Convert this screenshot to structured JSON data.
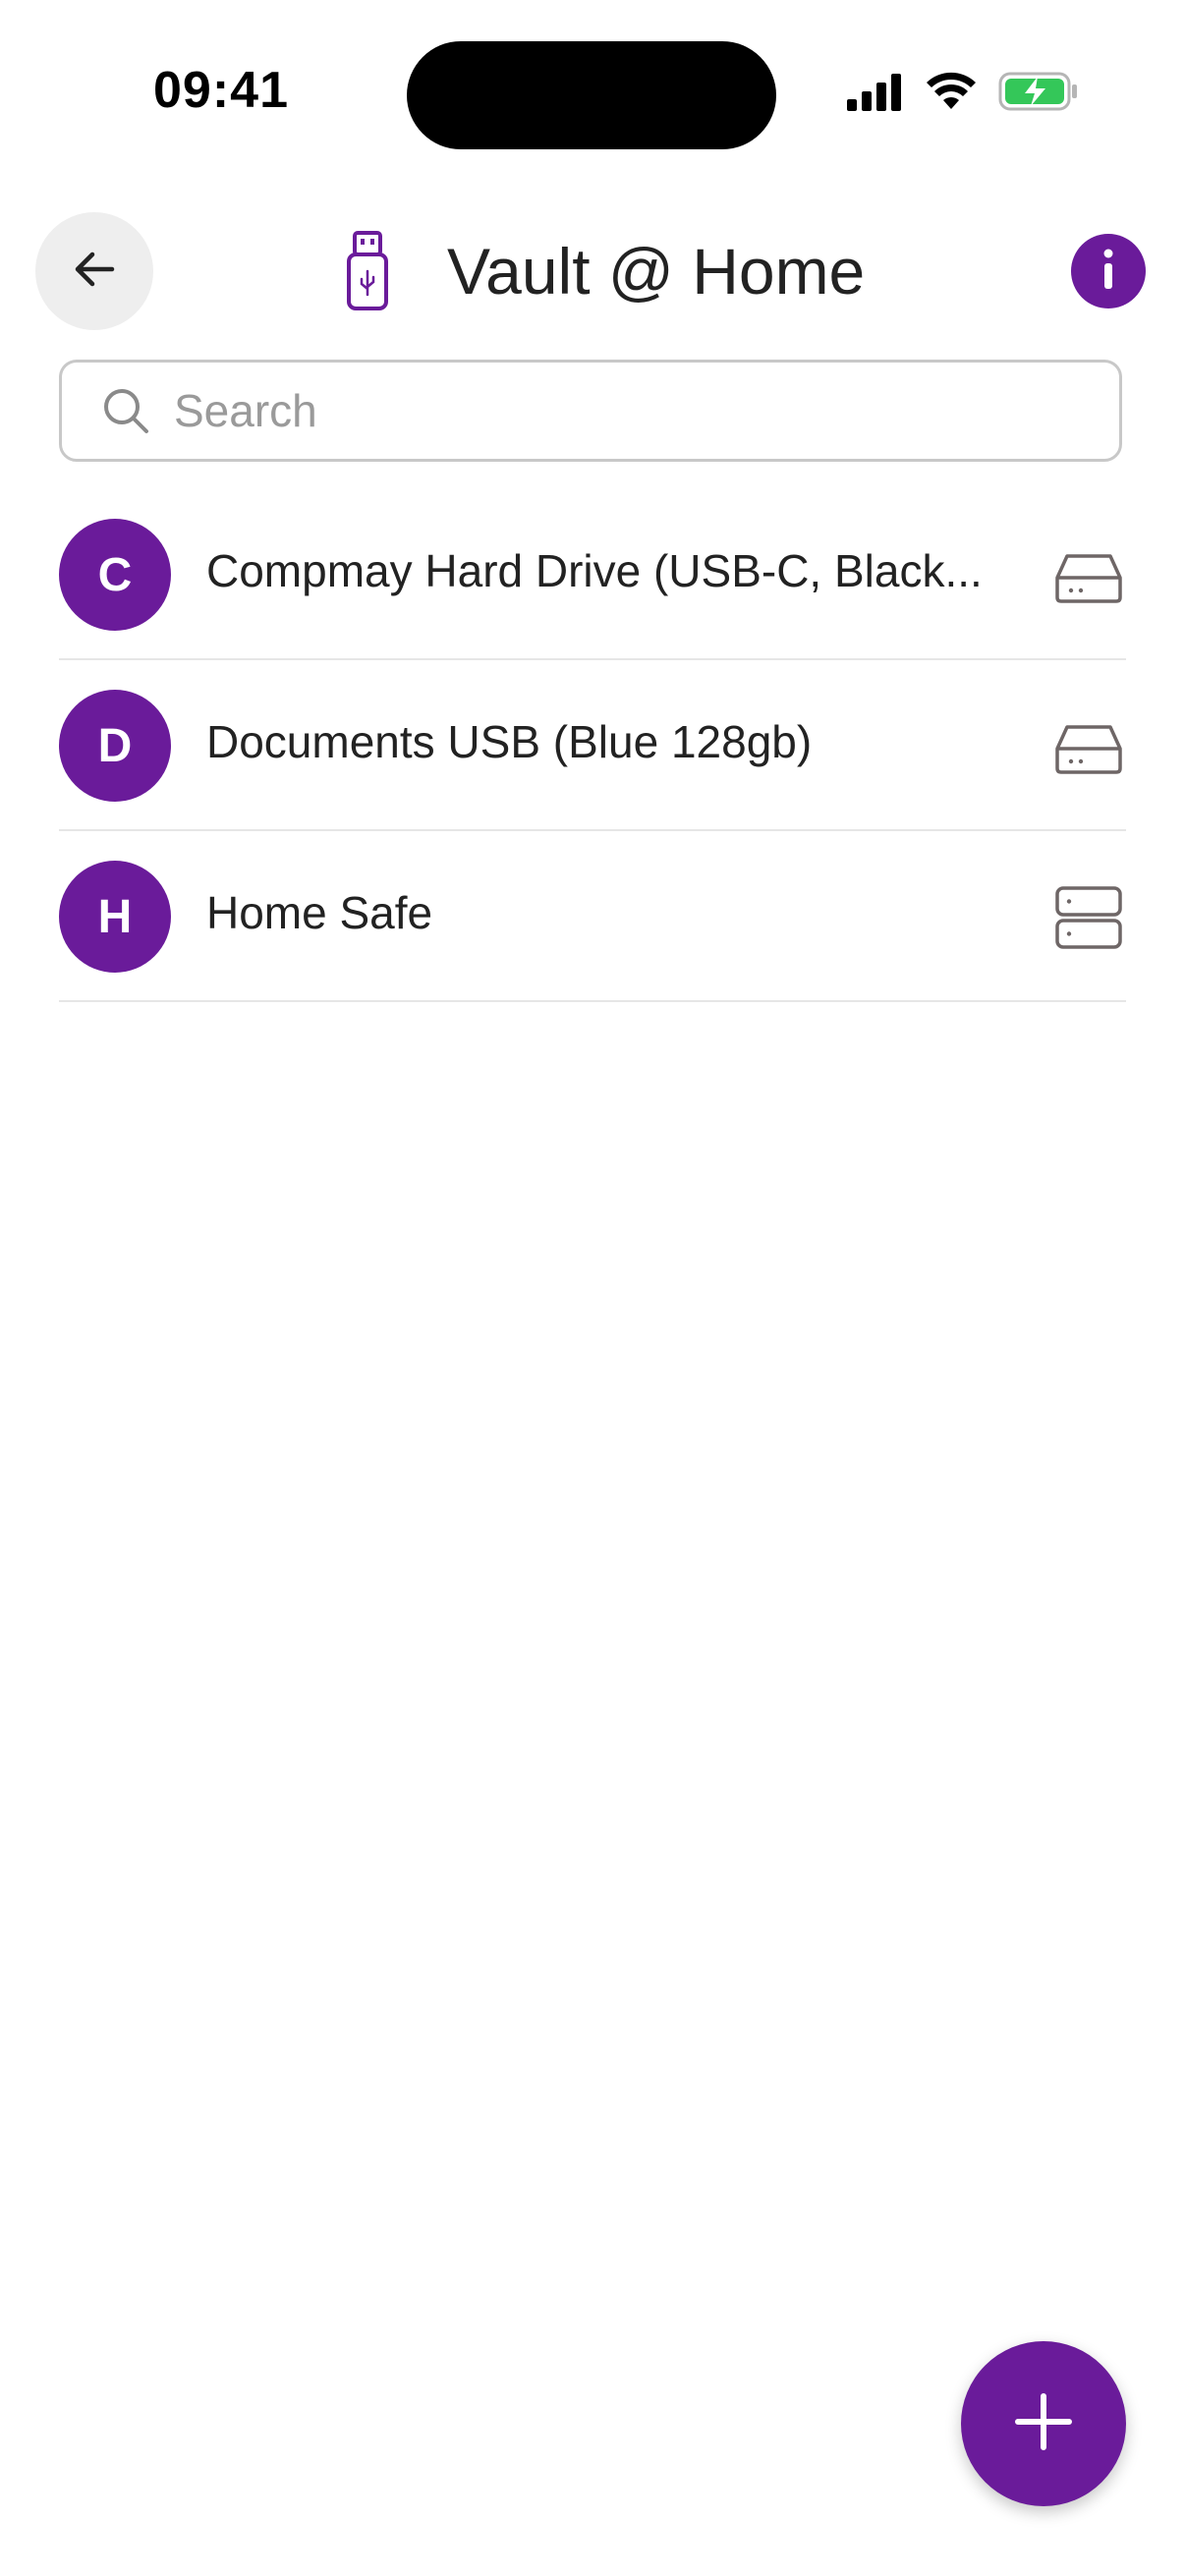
{
  "status_bar": {
    "time": "09:41",
    "icons": [
      "cellular-signal-icon",
      "wifi-icon",
      "battery-charging-icon"
    ]
  },
  "header": {
    "back_icon": "arrow-left-icon",
    "title_icon": "usb-drive-icon",
    "title": "Vault @ Home",
    "info_icon": "info-icon"
  },
  "search": {
    "placeholder": "Search",
    "value": ""
  },
  "items": [
    {
      "initial": "C",
      "label": "Compmay Hard Drive (USB-C, Black...",
      "icon": "hard-drive-icon"
    },
    {
      "initial": "D",
      "label": "Documents USB (Blue 128gb)",
      "icon": "hard-drive-icon"
    },
    {
      "initial": "H",
      "label": "Home Safe",
      "icon": "server-icon"
    }
  ],
  "fab": {
    "icon": "plus-icon"
  },
  "colors": {
    "accent": "#6a1b9a",
    "battery_green": "#34c759",
    "icon_gray": "#6e6666"
  }
}
